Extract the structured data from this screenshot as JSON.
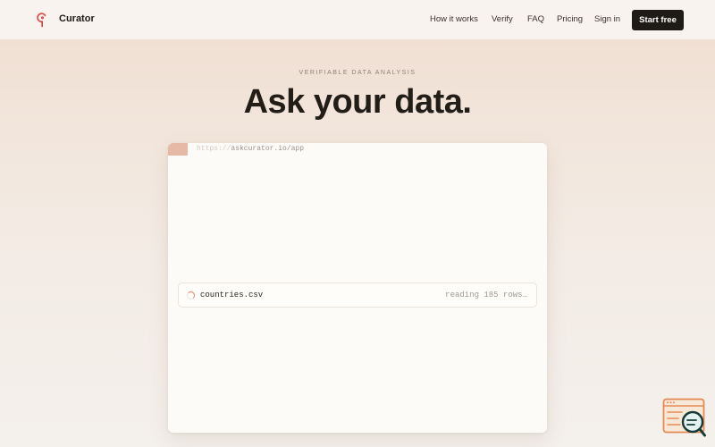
{
  "nav": {
    "brand": "Curator",
    "logo_icon": "curator-logo-icon",
    "links": [
      "How it works",
      "Verify",
      "FAQ",
      "Pricing",
      "Sign in"
    ],
    "cta": "Start free"
  },
  "hero": {
    "eyebrow": "VERIFIABLE DATA ANALYSIS",
    "headline": "Ask your data."
  },
  "app": {
    "url_protocol": "https://",
    "url_host": "askcurator.io/app",
    "file": {
      "name": "countries.csv",
      "status": "reading 185 rows…",
      "icon": "loading-spinner-icon"
    }
  },
  "widget": {
    "icon": "document-search-icon"
  },
  "colors": {
    "accent": "#e0806a",
    "dark": "#1e1a16",
    "tab": "#e6b8a6",
    "widget_stroke": "#e68a55",
    "widget_fill": "#f7e8d8"
  }
}
